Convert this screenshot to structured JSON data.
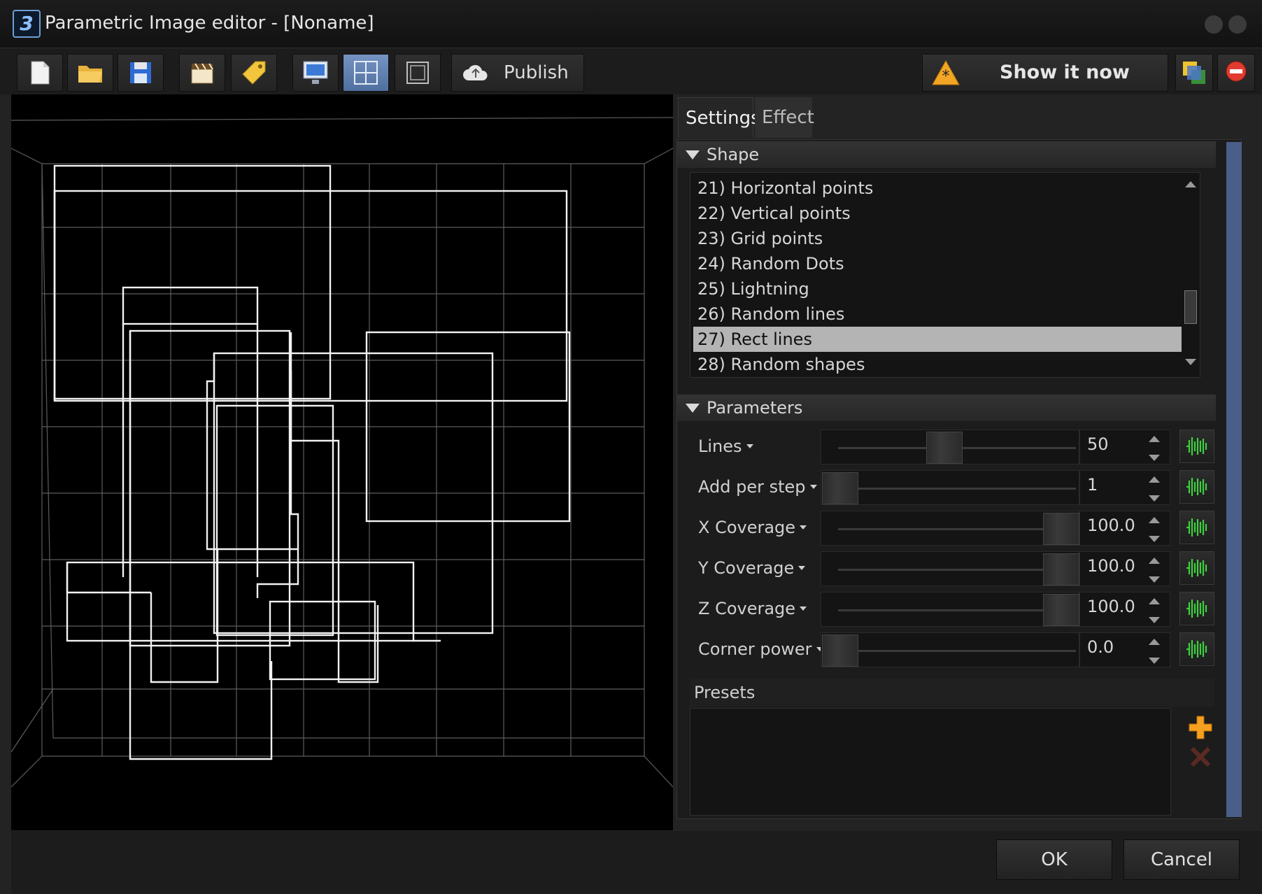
{
  "window": {
    "title": "Parametric Image editor - [Noname]"
  },
  "toolbar": {
    "publish_label": "Publish",
    "show_now_label": "Show it now"
  },
  "tabs": [
    {
      "label": "Settings",
      "active": true
    },
    {
      "label": "Effect",
      "active": false
    }
  ],
  "shape": {
    "header": "Shape",
    "items": [
      "21) Horizontal points",
      "22) Vertical points",
      "23) Grid points",
      "24) Random Dots",
      "25) Lightning",
      "26) Random lines",
      "27) Rect lines",
      "28) Random shapes"
    ],
    "selected": "27) Rect lines"
  },
  "parameters": {
    "header": "Parameters",
    "rows": [
      {
        "label": "Lines",
        "value": "50",
        "fraction": 0.47
      },
      {
        "label": "Add per step",
        "value": "1",
        "fraction": 0.0
      },
      {
        "label": "X Coverage",
        "value": "100.0",
        "fraction": 1.0
      },
      {
        "label": "Y Coverage",
        "value": "100.0",
        "fraction": 1.0
      },
      {
        "label": "Z Coverage",
        "value": "100.0",
        "fraction": 1.0
      },
      {
        "label": "Corner power",
        "value": "0.0",
        "fraction": 0.0
      }
    ]
  },
  "presets": {
    "label": "Presets"
  },
  "buttons": {
    "ok": "OK",
    "cancel": "Cancel"
  },
  "colors": {
    "accent": "#6f8fc0",
    "selection": "#b4b4b4",
    "scroll": "#4a5e8a"
  }
}
